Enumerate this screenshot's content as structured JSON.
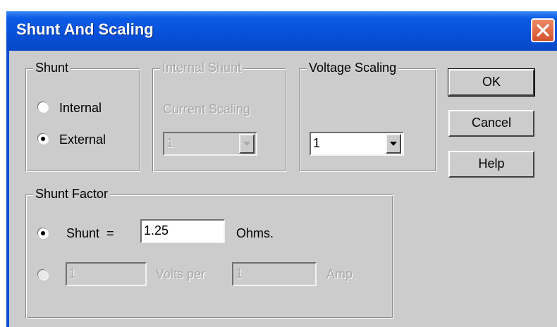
{
  "window": {
    "title": "Shunt And Scaling"
  },
  "shunt_group": {
    "legend": "Shunt",
    "options": [
      {
        "label": "Internal",
        "selected": false
      },
      {
        "label": "External",
        "selected": true
      }
    ]
  },
  "internal_shunt_group": {
    "legend": "Internal Shunt",
    "current_scaling_label": "Current Scaling",
    "current_scaling_value": "1",
    "enabled": false
  },
  "voltage_scaling_group": {
    "legend": "Voltage Scaling",
    "value": "1"
  },
  "buttons": {
    "ok": "OK",
    "cancel": "Cancel",
    "help": "Help"
  },
  "shunt_factor_group": {
    "legend": "Shunt Factor",
    "shunt_label": "Shunt  =",
    "shunt_value": "1.25",
    "shunt_unit": "Ohms.",
    "shunt_selected": true,
    "volts_value": "1",
    "volts_per_label": "Volts per",
    "amp_value": "1",
    "amp_label": "Amp.",
    "volts_selected": false
  },
  "icons": {
    "close": "close-icon",
    "dropdown": "chevron-down-icon"
  },
  "colors": {
    "titlebar": "#0750d8",
    "face": "#cccccc",
    "close": "#d4522d"
  }
}
